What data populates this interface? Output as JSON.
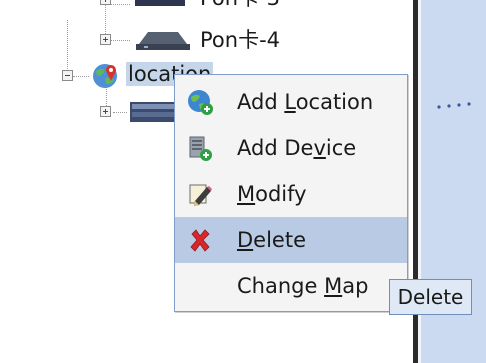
{
  "tree": {
    "nodes": [
      {
        "label": "Pon卡-3",
        "icon": "pon-card-icon",
        "expander": "plus"
      },
      {
        "label": "Pon卡-4",
        "icon": "pon-card-icon",
        "expander": "plus"
      },
      {
        "label": "location",
        "icon": "location-globe-icon",
        "expander": "minus",
        "selected": true
      },
      {
        "label": "",
        "icon": "device-rack-icon",
        "expander": "plus"
      }
    ]
  },
  "context_menu": {
    "items": [
      {
        "pre": "Add ",
        "mnemonic": "L",
        "post": "ocation",
        "icon": "add-location-icon"
      },
      {
        "pre": "Add De",
        "mnemonic": "v",
        "post": "ice",
        "icon": "add-device-icon"
      },
      {
        "pre": "",
        "mnemonic": "M",
        "post": "odify",
        "icon": "modify-pencil-icon"
      },
      {
        "pre": "",
        "mnemonic": "D",
        "post": "elete",
        "icon": "delete-x-icon",
        "active": true
      },
      {
        "pre": "Change ",
        "mnemonic": "M",
        "post": "ap",
        "icon": ""
      }
    ]
  },
  "tooltip": {
    "text": "Delete"
  },
  "colors": {
    "selection": "#b9cbe4",
    "menu_border": "#7f9fc9",
    "canvas": "#cbdaf0",
    "delete_red": "#d8262a"
  }
}
